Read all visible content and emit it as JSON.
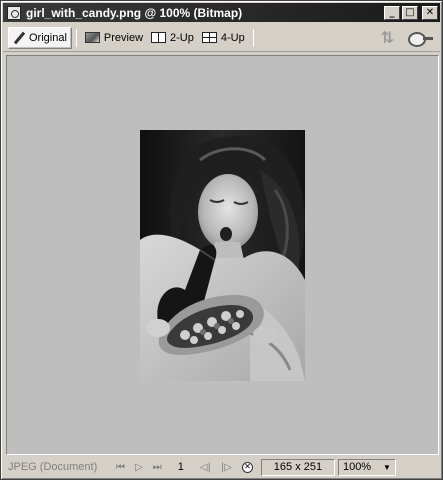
{
  "window": {
    "title": "girl_with_candy.png @ 100% (Bitmap)",
    "controls": {
      "minimize": "_",
      "maximize": "□",
      "close": "✕"
    }
  },
  "toolbar": {
    "tabs": [
      {
        "label": "Original",
        "icon": "pencil-icon",
        "active": true
      },
      {
        "label": "Preview",
        "icon": "preview-icon",
        "active": false
      },
      {
        "label": "2-Up",
        "icon": "two-up-icon",
        "active": false
      },
      {
        "label": "4-Up",
        "icon": "four-up-icon",
        "active": false
      }
    ],
    "right_icons": [
      "export-icon",
      "loupe-icon"
    ]
  },
  "canvas": {
    "background": "#bebebe",
    "image_alt": "black and white photo of a girl opening a heart-shaped box of candy"
  },
  "status": {
    "format": "JPEG (Document)",
    "page": "1",
    "dimensions": "165 x 251",
    "zoom": "100%"
  }
}
